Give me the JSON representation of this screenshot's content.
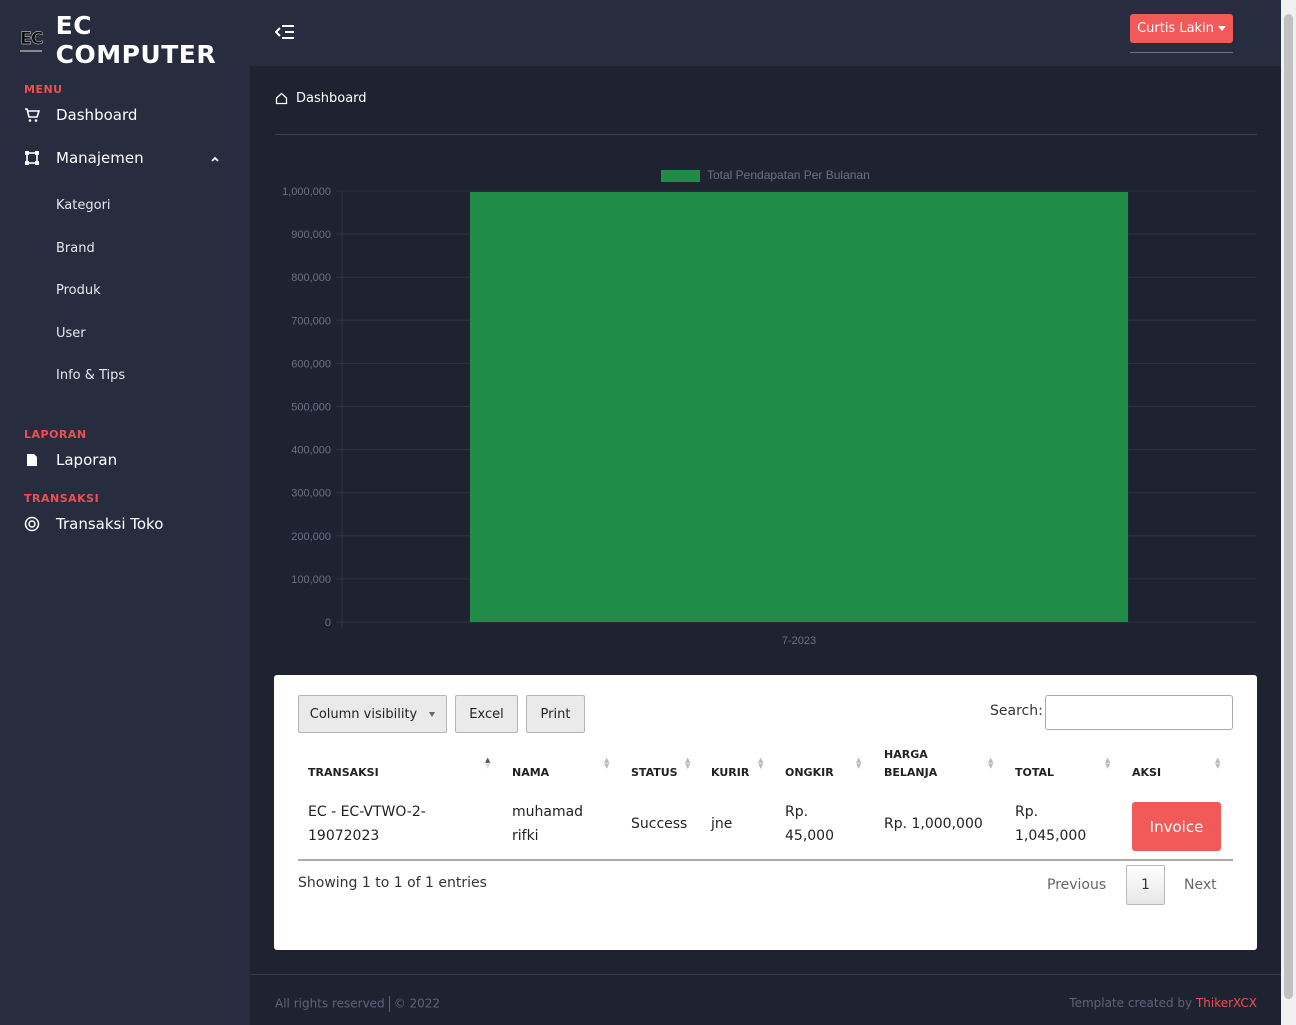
{
  "brand": {
    "logo_text": "EC",
    "name": "EC COMPUTER"
  },
  "sidebar": {
    "menu_label": "MENU",
    "dashboard": "Dashboard",
    "manajemen": "Manajemen",
    "sub_items": [
      "Kategori",
      "Brand",
      "Produk",
      "User",
      "Info & Tips"
    ],
    "laporan_label": "LAPORAN",
    "laporan": "Laporan",
    "transaksi_label": "TRANSAKSI",
    "transaksi_toko": "Transaksi Toko"
  },
  "header": {
    "user": "Curtis Lakin"
  },
  "breadcrumb": {
    "current": "Dashboard"
  },
  "chart_data": {
    "type": "bar",
    "categories": [
      "7-2023"
    ],
    "series": [
      {
        "name": "Total Pendapatan Per Bulanan",
        "values": [
          1000000
        ],
        "color": "#208c47"
      }
    ],
    "ylim": [
      0,
      1000000
    ],
    "yticks": [
      "1,000,000",
      "900,000",
      "800,000",
      "700,000",
      "600,000",
      "500,000",
      "400,000",
      "300,000",
      "200,000",
      "100,000",
      "0"
    ],
    "legend": "top-center",
    "grid": true
  },
  "table": {
    "buttons": {
      "colvis": "Column visibility",
      "excel": "Excel",
      "print": "Print"
    },
    "search_label": "Search:",
    "columns": [
      "TRANSAKSI",
      "NAMA",
      "STATUS",
      "KURIR",
      "ONGKIR",
      "HARGA BELANJA",
      "TOTAL",
      "AKSI"
    ],
    "column_lines": {
      "harga1": "HARGA",
      "harga2": "BELANJA"
    },
    "rows": [
      {
        "transaksi_1": "EC - EC-VTWO-2-",
        "transaksi_2": "19072023",
        "nama_1": "muhamad",
        "nama_2": "rifki",
        "status": "Success",
        "kurir": "jne",
        "ongkir_1": "Rp.",
        "ongkir_2": "45,000",
        "harga": "Rp. 1,000,000",
        "total_1": "Rp.",
        "total_2": "1,045,000",
        "aksi": "Invoice"
      }
    ],
    "info": "Showing 1 to 1 of 1 entries",
    "pagination": {
      "previous": "Previous",
      "page": "1",
      "next": "Next"
    }
  },
  "footer": {
    "left_a": "All rights reserved",
    "left_b": "© 2022",
    "right_prefix": "Template created by",
    "right_author": "ThikerXCX"
  }
}
